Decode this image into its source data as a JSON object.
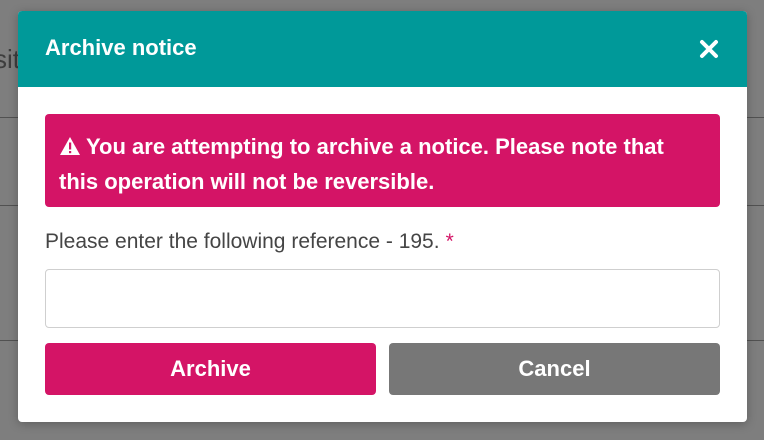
{
  "background": {
    "fragment_text": "sit"
  },
  "modal": {
    "title": "Archive notice",
    "close_icon": "close-icon",
    "alert": {
      "icon": "warning-icon",
      "message": "You are attempting to archive a notice. Please note that this operation will not be reversible."
    },
    "reference_field": {
      "label": "Please enter the following reference - 195.",
      "required_marker": "*",
      "value": "",
      "placeholder": ""
    },
    "archive_button_label": "Archive",
    "cancel_button_label": "Cancel"
  },
  "colors": {
    "header": "#009999",
    "danger": "#d41466",
    "cancel": "#777777"
  }
}
